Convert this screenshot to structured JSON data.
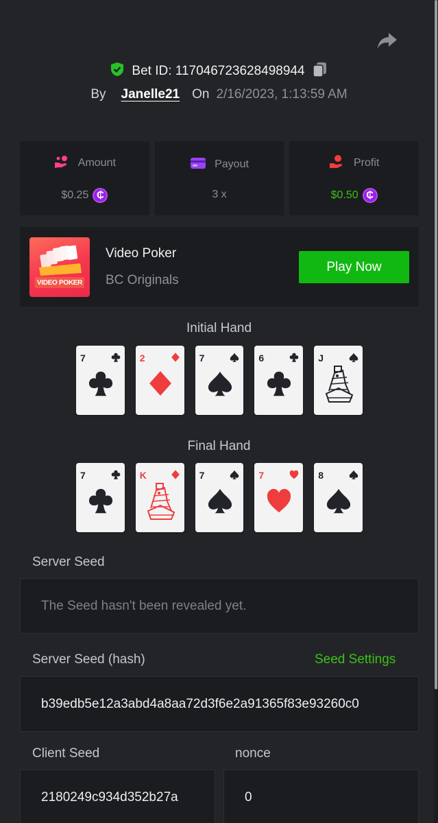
{
  "header": {
    "bet_id_label": "Bet ID:",
    "bet_id": "117046723628498944",
    "by_label": "By",
    "username": "Janelle21",
    "on_label": "On",
    "datetime": "2/16/2023, 1:13:59 AM"
  },
  "stats": {
    "amount_label": "Amount",
    "amount_value": "$0.25",
    "payout_label": "Payout",
    "payout_value": "3 x",
    "profit_label": "Profit",
    "profit_value": "$0.50",
    "coin_symbol": "₵"
  },
  "game": {
    "name": "Video Poker",
    "provider": "BC Originals",
    "thumb_text": "VIDEO POKER",
    "play_label": "Play Now"
  },
  "initial_hand": {
    "title": "Initial Hand",
    "cards": [
      {
        "rank": "7",
        "suit": "clubs"
      },
      {
        "rank": "2",
        "suit": "diamonds"
      },
      {
        "rank": "7",
        "suit": "spades"
      },
      {
        "rank": "6",
        "suit": "clubs"
      },
      {
        "rank": "J",
        "suit": "spades"
      }
    ]
  },
  "final_hand": {
    "title": "Final Hand",
    "cards": [
      {
        "rank": "7",
        "suit": "clubs"
      },
      {
        "rank": "K",
        "suit": "diamonds"
      },
      {
        "rank": "7",
        "suit": "spades"
      },
      {
        "rank": "7",
        "suit": "hearts"
      },
      {
        "rank": "8",
        "suit": "spades"
      }
    ]
  },
  "server_seed": {
    "label": "Server Seed",
    "value": "The Seed hasn't been revealed yet."
  },
  "server_seed_hash": {
    "label": "Server Seed (hash)",
    "settings_label": "Seed Settings",
    "value": "b39edb5e12a3abd4a8aa72d3f6e2a91365f83e93260c0"
  },
  "client_seed": {
    "label": "Client Seed",
    "value": "2180249c934d352b27a"
  },
  "nonce": {
    "label": "nonce",
    "value": "0"
  },
  "colors": {
    "background": "#232428",
    "panel": "#1b1c1f",
    "accent_green": "#3bc117",
    "play_button": "#12b812",
    "coin_purple": "#9b1fe6",
    "card_red": "#ef3d3d"
  },
  "icons": {
    "share": "share-icon",
    "verified": "shield-check-icon",
    "copy": "copy-icon",
    "amount": "hand-coin-icon",
    "payout": "card-wallet-icon",
    "profit": "hand-money-icon"
  }
}
